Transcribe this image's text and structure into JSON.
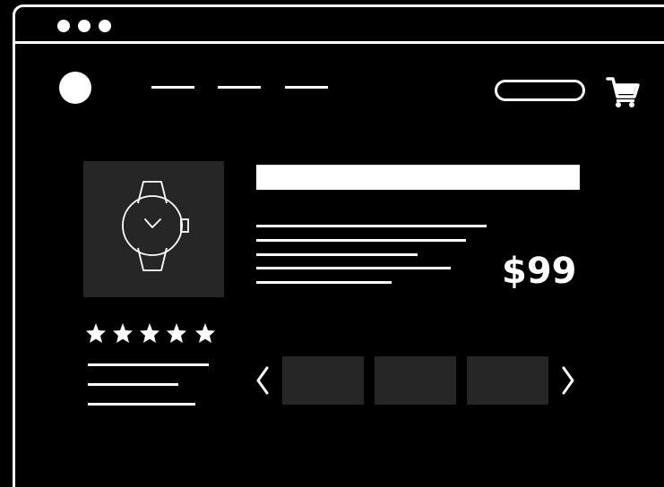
{
  "window": {
    "controls": [
      "window-dot-1",
      "window-dot-2",
      "window-dot-3"
    ]
  },
  "header": {
    "logo": "circle-logo",
    "nav_links": [
      "nav-link-1",
      "nav-link-2",
      "nav-link-3"
    ],
    "search": "search-bar",
    "cart_icon": "shopping-cart-icon"
  },
  "product": {
    "image_icon": "wristwatch-icon",
    "price": "$99",
    "rating": {
      "stars": 5,
      "max": 5,
      "icon": "star-icon"
    }
  },
  "gallery": {
    "prev_icon": "chevron-left-icon",
    "next_icon": "chevron-right-icon",
    "thumbnail_count": 3
  },
  "colors": {
    "background": "#000000",
    "foreground": "#ffffff",
    "panel": "#262626"
  }
}
